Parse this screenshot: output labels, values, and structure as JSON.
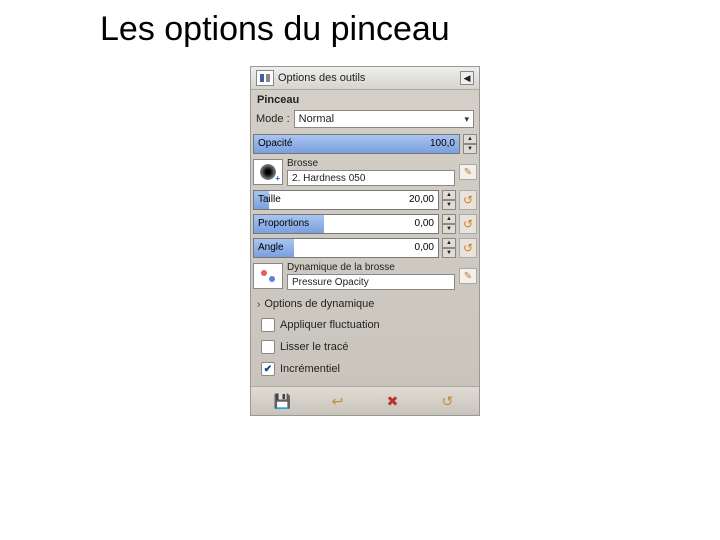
{
  "slide": {
    "title": "Les options du pinceau"
  },
  "panel": {
    "header": "Options des outils",
    "tool": "Pinceau",
    "mode_label": "Mode :",
    "mode_value": "Normal",
    "opacity": {
      "label": "Opacité",
      "value": "100,0"
    },
    "brush": {
      "section": "Brosse",
      "name": "2. Hardness 050"
    },
    "size": {
      "label": "Taille",
      "value": "20,00"
    },
    "ratio": {
      "label": "Proportions",
      "value": "0,00"
    },
    "angle": {
      "label": "Angle",
      "value": "0,00"
    },
    "dynamics": {
      "section": "Dynamique de la brosse",
      "name": "Pressure Opacity"
    },
    "options_dyn": "Options de dynamique",
    "jitter": "Appliquer fluctuation",
    "smooth": "Lisser le tracé",
    "incremental": "Incrémentiel"
  }
}
